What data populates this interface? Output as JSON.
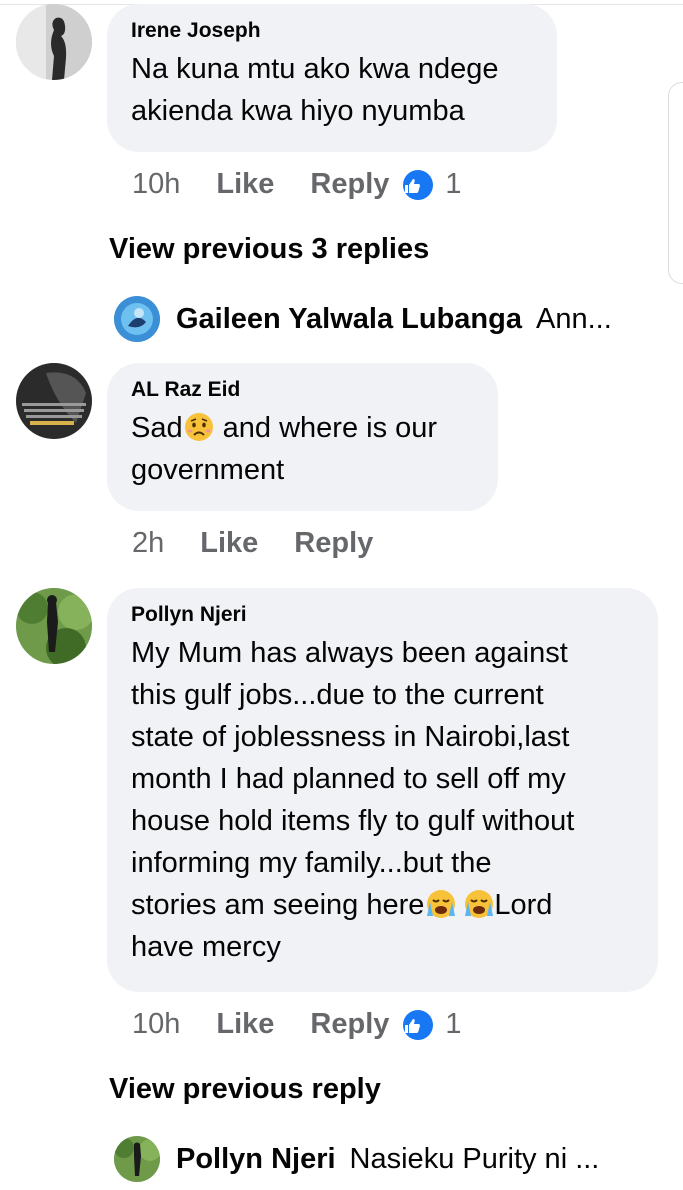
{
  "comments": [
    {
      "author": "Irene Joseph",
      "text_lines": [
        "Na kuna mtu ako kwa ndege",
        "akienda kwa hiyo nyumba"
      ],
      "time": "10h",
      "like_label": "Like",
      "reply_label": "Reply",
      "reactions": "1"
    },
    {
      "author": "AL Raz Eid",
      "text_lines": [
        "Sad",
        " and where is our",
        "government"
      ],
      "time": "2h",
      "like_label": "Like",
      "reply_label": "Reply"
    },
    {
      "author": "Pollyn Njeri",
      "text_lines": [
        "My Mum has always been against",
        "this gulf jobs...due to the current",
        "state of joblessness in Nairobi,last",
        "month I had planned to sell off my",
        "house hold items fly to gulf without",
        "informing my family...but the",
        "stories am seeing here",
        "Lord",
        "have mercy"
      ],
      "time": "10h",
      "like_label": "Like",
      "reply_label": "Reply",
      "reactions": "1"
    }
  ],
  "view_previous_1": "View previous 3 replies",
  "reply_preview_1": {
    "name": "Gaileen Yalwala Lubanga",
    "snippet": "Ann..."
  },
  "view_previous_2": "View previous reply",
  "reply_preview_2": {
    "name": "Pollyn Njeri",
    "snippet": "Nasieku Purity ni ..."
  },
  "colors": {
    "bubble": "#f0f2f5",
    "muted": "#65676b",
    "like_blue": "#1877f2"
  },
  "icons": {
    "like_reaction": "thumbs-up-icon",
    "sad_emoji": "sad-face-emoji",
    "crying_emoji": "loudly-crying-face-emoji"
  }
}
